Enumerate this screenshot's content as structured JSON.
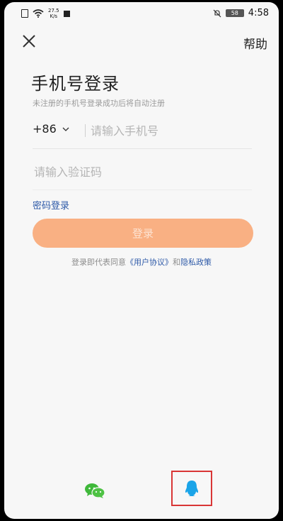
{
  "status_bar": {
    "net_speed_value": "27.5",
    "net_speed_unit": "K/s",
    "battery": "58",
    "time": "4:58"
  },
  "header": {
    "close_icon": "close-icon",
    "help_label": "帮助"
  },
  "login": {
    "title": "手机号登录",
    "subtitle": "未注册的手机号登录成功后将自动注册",
    "country_code": "+86",
    "phone_placeholder": "请输入手机号",
    "code_placeholder": "请输入验证码",
    "password_login_label": "密码登录",
    "login_button": "登录"
  },
  "agreement": {
    "prefix": "登录即代表同意",
    "user_agreement": "《用户协议》",
    "and": "和",
    "privacy_policy": "隐私政策"
  },
  "third_party": {
    "wechat_icon": "wechat-icon",
    "qq_icon": "qq-icon"
  },
  "colors": {
    "accent_orange": "#f9b083",
    "link_blue": "#2e5aa8",
    "highlight_red": "#d93636"
  }
}
